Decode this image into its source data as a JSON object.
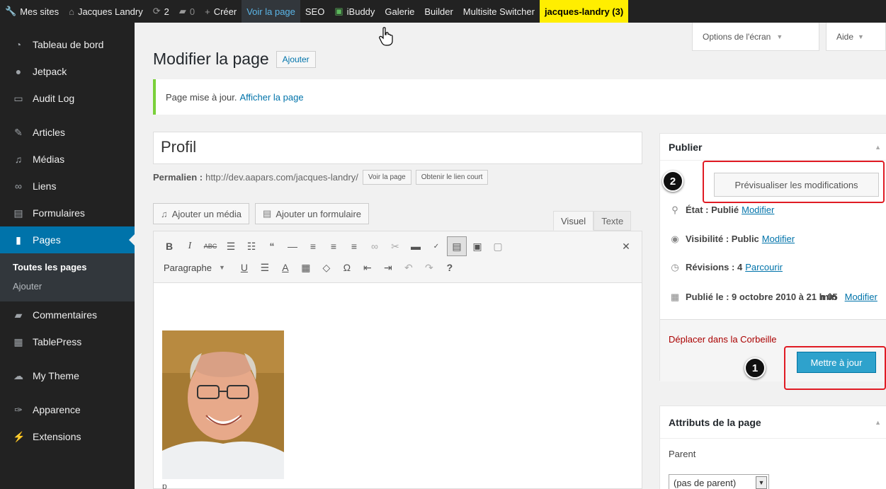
{
  "admin_bar": {
    "my_sites": "Mes sites",
    "site_name": "Jacques Landry",
    "updates": "2",
    "comments": "0",
    "new": "Créer",
    "view_page": "Voir la page",
    "seo": "SEO",
    "ibuddy": "iBuddy",
    "gallery": "Galerie",
    "builder": "Builder",
    "multisite": "Multisite Switcher",
    "user": "jacques-landry (3)"
  },
  "screen_options": "Options de l'écran",
  "help": "Aide",
  "sidebar": {
    "items": [
      {
        "label": "Tableau de bord",
        "icon": "dashboard-icon"
      },
      {
        "label": "Jetpack",
        "icon": "jetpack-icon"
      },
      {
        "label": "Audit Log",
        "icon": "audit-icon"
      },
      {
        "label": "Articles",
        "icon": "pin-icon"
      },
      {
        "label": "Médias",
        "icon": "media-icon"
      },
      {
        "label": "Liens",
        "icon": "link-icon"
      },
      {
        "label": "Formulaires",
        "icon": "forms-icon"
      },
      {
        "label": "Pages",
        "icon": "pages-icon"
      }
    ],
    "sub": [
      "Toutes les pages",
      "Ajouter"
    ],
    "items2": [
      {
        "label": "Commentaires",
        "icon": "comment-icon"
      },
      {
        "label": "TablePress",
        "icon": "table-icon"
      },
      {
        "label": "My Theme",
        "icon": "theme-icon"
      },
      {
        "label": "Apparence",
        "icon": "appearance-icon"
      },
      {
        "label": "Extensions",
        "icon": "plugin-icon"
      }
    ]
  },
  "page": {
    "title": "Modifier la page",
    "add_label": "Ajouter",
    "notice_text": "Page mise à jour.",
    "notice_link": "Afficher la page",
    "post_title": "Profil",
    "permalink_label": "Permalien :",
    "permalink_url": "http://dev.aapars.com/jacques-landry/",
    "view_btn": "Voir la page",
    "shortlink_btn": "Obtenir le lien court",
    "add_media": "Ajouter un média",
    "add_form": "Ajouter un formulaire",
    "tab_visual": "Visuel",
    "tab_text": "Texte",
    "format_select": "Paragraphe",
    "editor_footer": "p"
  },
  "publish": {
    "title": "Publier",
    "preview_btn": "Prévisualiser les modifications",
    "status_label": "État : Publié",
    "status_link": "Modifier",
    "visibility_label": "Visibilité : Public",
    "visibility_link": "Modifier",
    "revisions_label": "Révisions : 4",
    "revisions_link": "Parcourir",
    "published_label": "Publié le : 9 octobre 2010 à 21 h 05",
    "published_label2": "min",
    "published_link": "Modifier",
    "trash": "Déplacer dans la Corbeille",
    "update_btn": "Mettre à jour"
  },
  "attributes": {
    "title": "Attributs de la page",
    "parent_label": "Parent",
    "parent_value": "(pas de parent)"
  },
  "callouts": [
    "1",
    "2"
  ],
  "colors": {
    "admin_bar": "#222222",
    "accent": "#0073aa",
    "highlight": "#ffee00",
    "callout_border": "#e01b24"
  }
}
